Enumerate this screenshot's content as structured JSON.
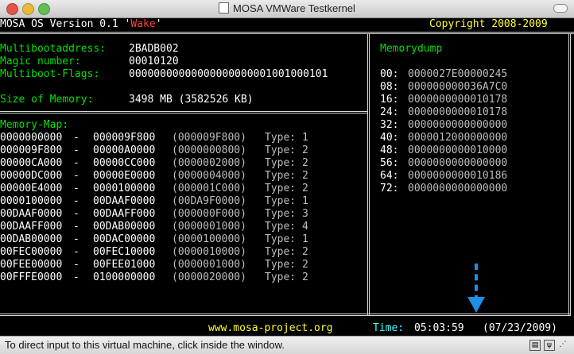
{
  "window": {
    "title": "MOSA VMWare Testkernel"
  },
  "header": {
    "os_prefix": "MOSA OS Version 0.1 '",
    "os_codename": "Wake",
    "os_suffix": "'",
    "copyright": "Copyright 2008-2009"
  },
  "info": {
    "multiboot_label": "Multibootaddress:",
    "multiboot_value": "2BADB002",
    "magic_label": "Magic number:",
    "magic_value": "00010120",
    "flags_label": "Multiboot-Flags:",
    "flags_value": "00000000000000000000001001000101",
    "size_label": "Size of Memory:",
    "size_value": "3498 MB (3582526 KB)"
  },
  "memory_map": {
    "title": "Memory-Map:",
    "rows": [
      {
        "start": "0000000000",
        "end": "000009F800",
        "size": "(000009F800)",
        "type": "Type: 1"
      },
      {
        "start": "000009F800",
        "end": "00000A0000",
        "size": "(0000000800)",
        "type": "Type: 2"
      },
      {
        "start": "00000CA000",
        "end": "00000CC000",
        "size": "(0000002000)",
        "type": "Type: 2"
      },
      {
        "start": "00000DC000",
        "end": "00000E0000",
        "size": "(0000004000)",
        "type": "Type: 2"
      },
      {
        "start": "00000E4000",
        "end": "0000100000",
        "size": "(000001C000)",
        "type": "Type: 2"
      },
      {
        "start": "0000100000",
        "end": "00DAAF0000",
        "size": "(00DA9F0000)",
        "type": "Type: 1"
      },
      {
        "start": "00DAAF0000",
        "end": "00DAAFF000",
        "size": "(000000F000)",
        "type": "Type: 3"
      },
      {
        "start": "00DAAFF000",
        "end": "00DAB00000",
        "size": "(0000001000)",
        "type": "Type: 4"
      },
      {
        "start": "00DAB00000",
        "end": "00DAC00000",
        "size": "(0000100000)",
        "type": "Type: 1"
      },
      {
        "start": "00FEC00000",
        "end": "00FEC10000",
        "size": "(0000010000)",
        "type": "Type: 2"
      },
      {
        "start": "00FEE00000",
        "end": "00FEE01000",
        "size": "(0000001000)",
        "type": "Type: 2"
      },
      {
        "start": "00FFFE0000",
        "end": "0100000000",
        "size": "(0000020000)",
        "type": "Type: 2"
      }
    ]
  },
  "memorydump": {
    "title": "Memorydump",
    "rows": [
      {
        "offset": "00:",
        "value": "0000027E00000245"
      },
      {
        "offset": "08:",
        "value": "000000000036A7C0"
      },
      {
        "offset": "16:",
        "value": "0000000000010178"
      },
      {
        "offset": "24:",
        "value": "0000000000010178"
      },
      {
        "offset": "32:",
        "value": "0000000000000000"
      },
      {
        "offset": "40:",
        "value": "0000012000000000"
      },
      {
        "offset": "48:",
        "value": "0000000000010000"
      },
      {
        "offset": "56:",
        "value": "0000000000000000"
      },
      {
        "offset": "64:",
        "value": "0000000000010186"
      },
      {
        "offset": "72:",
        "value": "0000000000000000"
      }
    ]
  },
  "footer": {
    "website": "www.mosa-project.org",
    "time_label": "Time:",
    "time_value": "05:03:59",
    "date_value": "(07/23/2009)"
  },
  "statusbar": {
    "message": "To direct input to this virtual machine, click inside the window."
  },
  "icons": {
    "annotation_arrow": "arrow-down-dashed-icon",
    "arrow_color": "#1e90e0"
  }
}
